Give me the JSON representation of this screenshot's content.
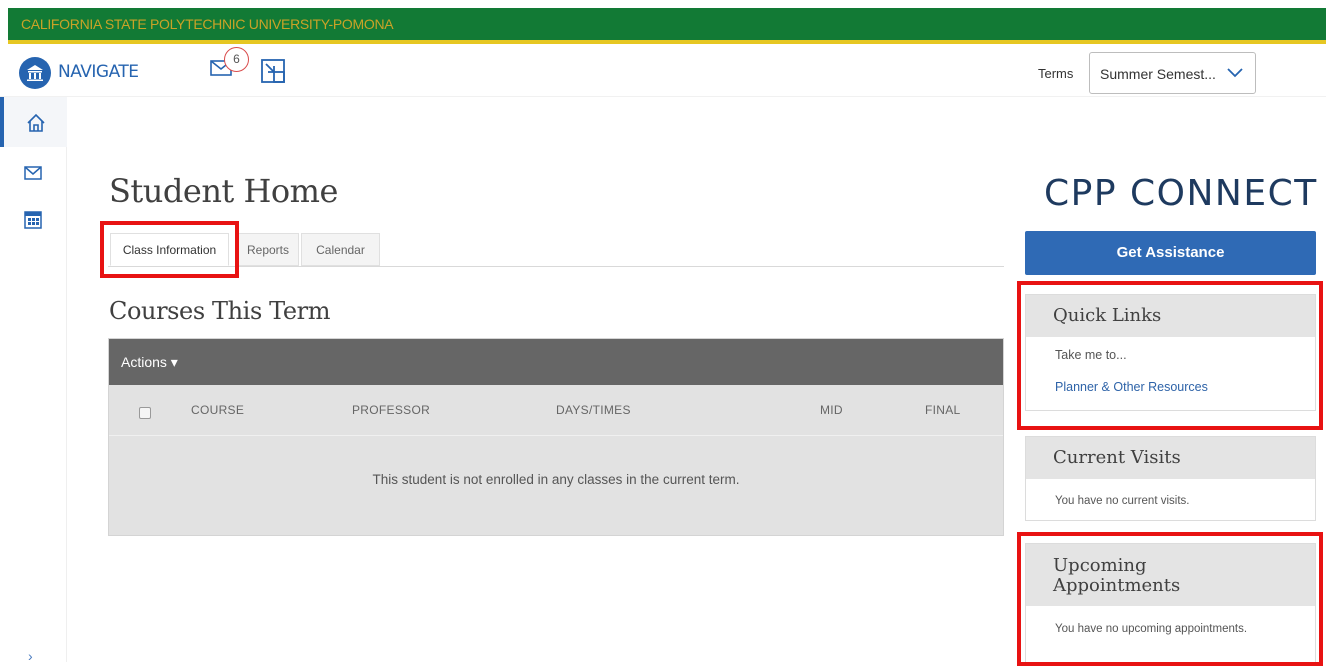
{
  "banner": {
    "university": "CALIFORNIA STATE POLYTECHNIC UNIVERSITY-POMONA"
  },
  "header": {
    "app_name": "NAVIGATE",
    "message_count": "6",
    "terms_label": "Terms",
    "terms_value": "Summer Semest..."
  },
  "main": {
    "page_title": "Student Home",
    "tabs": [
      {
        "label": "Class Information"
      },
      {
        "label": "Reports"
      },
      {
        "label": "Calendar"
      }
    ],
    "section_title": "Courses This Term",
    "actions_label": "Actions ▾",
    "columns": [
      "COURSE",
      "PROFESSOR",
      "DAYS/TIMES",
      "MID",
      "FINAL"
    ],
    "empty_message": "This student is not enrolled in any classes in the current term."
  },
  "right": {
    "brand": "CPP CONNECT",
    "assist_button": "Get Assistance",
    "quick_links": {
      "title": "Quick Links",
      "intro": "Take me to...",
      "link": "Planner & Other Resources"
    },
    "current_visits": {
      "title": "Current Visits",
      "message": "You have no current visits."
    },
    "upcoming": {
      "title_line1": "Upcoming",
      "title_line2": "Appointments",
      "message": "You have no upcoming appointments."
    }
  },
  "colors": {
    "banner_green": "#127a35",
    "banner_gold": "#e6c722",
    "brand_blue": "#2664b0",
    "highlight_red": "#e81212"
  }
}
